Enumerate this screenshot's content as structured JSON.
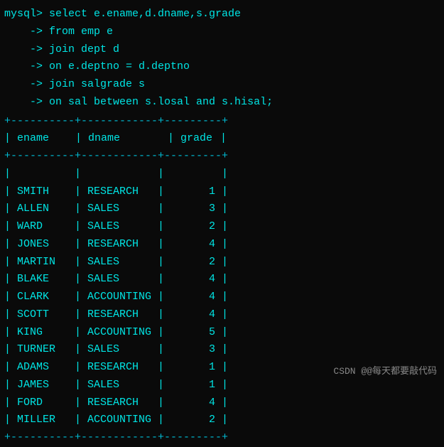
{
  "terminal": {
    "prompt": "mysql>",
    "query_lines": [
      {
        "prefix": "mysql>",
        "text": " select e.ename,d.dname,s.grade"
      },
      {
        "prefix": "    ->",
        "text": " from emp e"
      },
      {
        "prefix": "    ->",
        "text": " join dept d"
      },
      {
        "prefix": "    ->",
        "text": " on e.deptno = d.deptno"
      },
      {
        "prefix": "    ->",
        "text": " join salgrade s"
      },
      {
        "prefix": "    ->",
        "text": " on sal between s.losal and s.hisal;"
      }
    ],
    "table": {
      "separator": "+----------+------------+---------+",
      "header": {
        "ename": "ename",
        "dname": "dname",
        "grade": "grade"
      },
      "rows": [
        {
          "ename": "SMITH",
          "dname": "RESEARCH",
          "grade": "1"
        },
        {
          "ename": "ALLEN",
          "dname": "SALES",
          "grade": "3"
        },
        {
          "ename": "WARD",
          "dname": "SALES",
          "grade": "2"
        },
        {
          "ename": "JONES",
          "dname": "RESEARCH",
          "grade": "4"
        },
        {
          "ename": "MARTIN",
          "dname": "SALES",
          "grade": "2"
        },
        {
          "ename": "BLAKE",
          "dname": "SALES",
          "grade": "4"
        },
        {
          "ename": "CLARK",
          "dname": "ACCOUNTING",
          "grade": "4"
        },
        {
          "ename": "SCOTT",
          "dname": "RESEARCH",
          "grade": "4"
        },
        {
          "ename": "KING",
          "dname": "ACCOUNTING",
          "grade": "5"
        },
        {
          "ename": "TURNER",
          "dname": "SALES",
          "grade": "3"
        },
        {
          "ename": "ADAMS",
          "dname": "RESEARCH",
          "grade": "1"
        },
        {
          "ename": "JAMES",
          "dname": "SALES",
          "grade": "1"
        },
        {
          "ename": "FORD",
          "dname": "RESEARCH",
          "grade": "4"
        },
        {
          "ename": "MILLER",
          "dname": "ACCOUNTING",
          "grade": "2"
        }
      ]
    },
    "watermark": "CSDN @@每天都要敲代码"
  }
}
